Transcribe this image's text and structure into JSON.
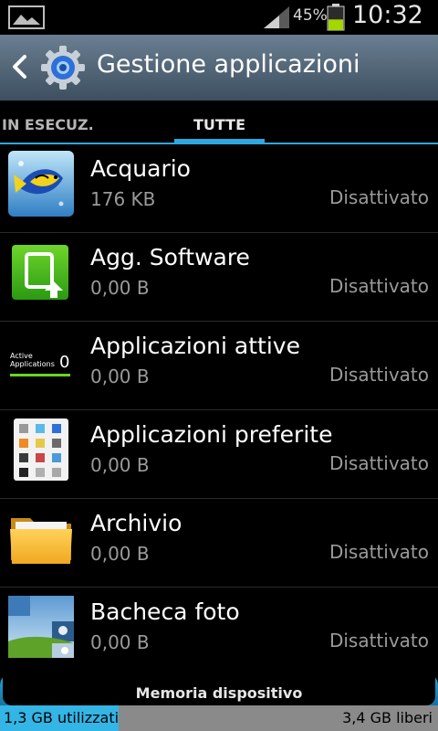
{
  "status_bar": {
    "battery_percent": "45%",
    "battery_level": 0.45,
    "time": "10:32"
  },
  "action_bar": {
    "title": "Gestione applicazioni"
  },
  "tabs": [
    {
      "label": "IN ESECUZ.",
      "selected": false
    },
    {
      "label": "TUTTE",
      "selected": true
    }
  ],
  "apps": [
    {
      "name": "Acquario",
      "size": "176 KB",
      "status": "Disattivato",
      "icon": "aquarium-fish-icon"
    },
    {
      "name": "Agg. Software",
      "size": "0,00 B",
      "status": "Disattivato",
      "icon": "software-update-icon"
    },
    {
      "name": "Applicazioni attive",
      "size": "0,00 B",
      "status": "Disattivato",
      "icon": "active-applications-icon",
      "icon_text": "Active Applications",
      "icon_count": "0"
    },
    {
      "name": "Applicazioni preferite",
      "size": "0,00 B",
      "status": "Disattivato",
      "icon": "favorite-apps-icon"
    },
    {
      "name": "Archivio",
      "size": "0,00 B",
      "status": "Disattivato",
      "icon": "folder-icon"
    },
    {
      "name": "Bacheca foto",
      "size": "0,00 B",
      "status": "Disattivato",
      "icon": "photo-wall-icon"
    }
  ],
  "storage": {
    "label": "Memoria dispositivo",
    "used": "1,3 GB utilizzati",
    "free": "3,4 GB liberi",
    "used_fraction": 0.27
  },
  "colors": {
    "accent": "#2ea8e0",
    "action_bar_top": "#6a7f92",
    "action_bar_bottom": "#3d4f5f",
    "secondary_text": "#9a9a9a"
  }
}
